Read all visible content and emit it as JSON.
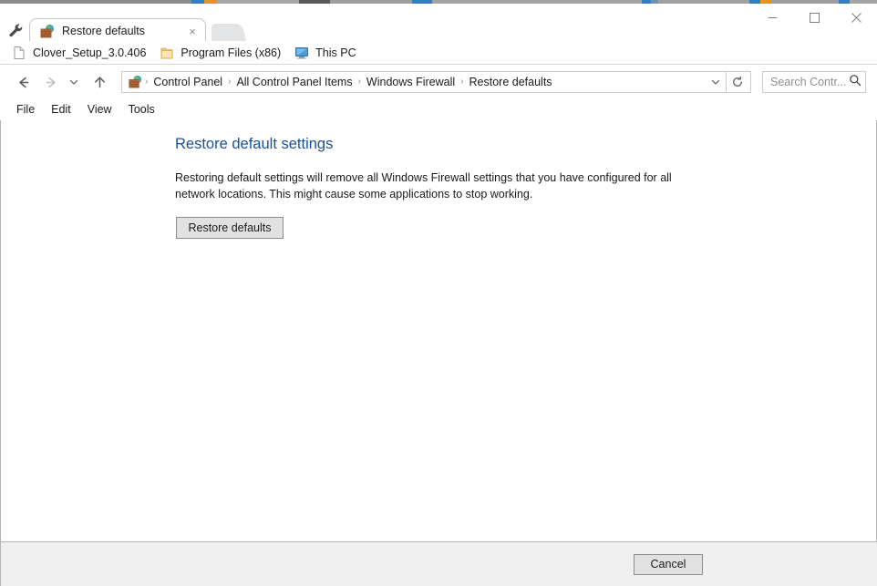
{
  "window": {
    "background_sliver_colors": [
      "#7b7b7b",
      "#2f7fc1",
      "#e8921f",
      "#5a5a5a",
      "#2f7fc1",
      "#bfbfbf"
    ],
    "controls": [
      {
        "name": "minimize",
        "glyph": "—"
      },
      {
        "name": "maximize",
        "glyph": "□"
      },
      {
        "name": "close",
        "glyph": "✕"
      }
    ]
  },
  "tabstrip": {
    "tool_icon": "wrench-icon",
    "tabs": [
      {
        "title": "Restore defaults",
        "favicon": "windows-firewall-icon",
        "close_glyph": "×",
        "active": true
      }
    ],
    "new_tab_label": ""
  },
  "bookmarks": {
    "items": [
      {
        "label": "Clover_Setup_3.0.406",
        "icon": "file-icon"
      },
      {
        "label": "Program Files (x86)",
        "icon": "folder-icon"
      },
      {
        "label": "This PC",
        "icon": "computer-icon"
      }
    ]
  },
  "addressbar": {
    "back_glyph": "←",
    "forward_glyph": "→",
    "recent_glyph": "⌄",
    "up_glyph": "↑",
    "path_icon": "windows-firewall-icon",
    "separator": "›",
    "crumbs": [
      "Control Panel",
      "All Control Panel Items",
      "Windows Firewall",
      "Restore defaults"
    ],
    "dropdown_glyph": "⌄",
    "refresh_glyph": "↻",
    "search": {
      "placeholder": "Search Contr...",
      "value": "",
      "icon": "search-icon"
    }
  },
  "menubar": {
    "items": [
      "File",
      "Edit",
      "View",
      "Tools"
    ]
  },
  "main": {
    "title": "Restore default settings",
    "title_color": "#1b4f9c",
    "description": "Restoring default settings will remove all Windows Firewall settings that you have configured for all network locations. This might cause some applications to stop working.",
    "restore_button": "Restore defaults"
  },
  "footer": {
    "cancel_button": "Cancel"
  }
}
